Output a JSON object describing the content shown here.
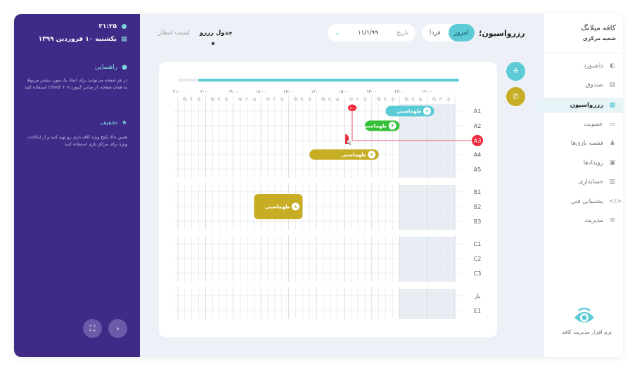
{
  "left_panel": {
    "time": "۲۱:۲۵",
    "date": "یکشنبه ۱۰ فروردین ۱۳۹۹",
    "guide_title": "راهنمایی",
    "guide_text": "در هر صفحه می‌توانید برای ایجاد یک مورد بیشتر مربوط به همان صفحه، از میانبر کیبورد cmnd + n استفاده کنید",
    "discount_title": "تخفیف",
    "discount_text": "همین حالا پکیج ویژه کافه بازی رو تهیه کنید و از امکانات ویژه برای مراکز بازی استفاده کنید."
  },
  "nav": {
    "brand": "کافه میلانگ",
    "branch": "شعبه مرکزی",
    "items": [
      {
        "label": "داشبورد",
        "icon": "gauge-icon",
        "glyph": "◐"
      },
      {
        "label": "صندوق",
        "icon": "cash-register-icon",
        "glyph": "▤"
      },
      {
        "label": "رزرواسیون",
        "icon": "calendar-grid-icon",
        "glyph": "▦"
      },
      {
        "label": "عضویت",
        "icon": "id-card-icon",
        "glyph": "▭"
      },
      {
        "label": "قفسه بازی‌ها",
        "icon": "shelf-icon",
        "glyph": "♟"
      },
      {
        "label": "رویدادها",
        "icon": "calendar-icon",
        "glyph": "▣"
      },
      {
        "label": "حسابداری",
        "icon": "calculator-icon",
        "glyph": "▥"
      },
      {
        "label": "پشتیبانی فنی",
        "icon": "code-icon",
        "glyph": "</>"
      },
      {
        "label": "مدیریت",
        "icon": "gear-icon",
        "glyph": "⚙"
      }
    ],
    "footer": "نرم افزار مدیریت کافه"
  },
  "header": {
    "tab_active": "جدول رزرو",
    "tab_inactive": "لیست انتظار",
    "date_label": "تاریخ",
    "date_value": "۱۱/۱/۹۹",
    "today": "امروز",
    "tomorrow": "فردا",
    "title": "رزرواسیون؛"
  },
  "schedule": {
    "hours": [
      "۲۱:۰۰",
      "۲۰:۰۰",
      "۱۹:۰۰",
      "۱۸:۰۰",
      "۱۷:۰۰",
      "۱۶:۰۰",
      "۱۵:۰۰",
      "۱۴:۰۰",
      "۱۳:۰۰",
      "۱۲:۰۰"
    ],
    "minutes": [
      "۴۵",
      "۳۰",
      "۱۵"
    ],
    "first_minute": "۰",
    "groups": [
      [
        "A1",
        "A2",
        "A3",
        "A4",
        "A5"
      ],
      [
        "B1",
        "B2",
        "B3"
      ],
      [
        "C1",
        "C2",
        "C3"
      ],
      [
        "بار",
        "E1"
      ]
    ],
    "active_row": "A3",
    "current_time_marker": "۲۰",
    "bookings": [
      {
        "table": "A1",
        "label": "طهماسبی",
        "count": "۴",
        "color": "#5ccbd6",
        "start": "14:30",
        "end": "12:45"
      },
      {
        "table": "A2",
        "label": "طهماسبی",
        "count": "۴",
        "color": "#33c036",
        "start": "15:15",
        "end": "14:00"
      },
      {
        "table": "A4",
        "label": "طهماسبی",
        "count": "۴",
        "color": "#c7ad23",
        "start": "17:15",
        "end": "14:45"
      },
      {
        "table": "B2",
        "label": "طهماسبی",
        "count": "۸",
        "color": "#c7ad23",
        "start": "19:15",
        "end": "17:30"
      }
    ]
  },
  "colors": {
    "purple": "#3f2b87",
    "teal": "#5ccbd6",
    "gold": "#c7ad23",
    "green": "#33c036",
    "red": "#ee2a3b"
  }
}
